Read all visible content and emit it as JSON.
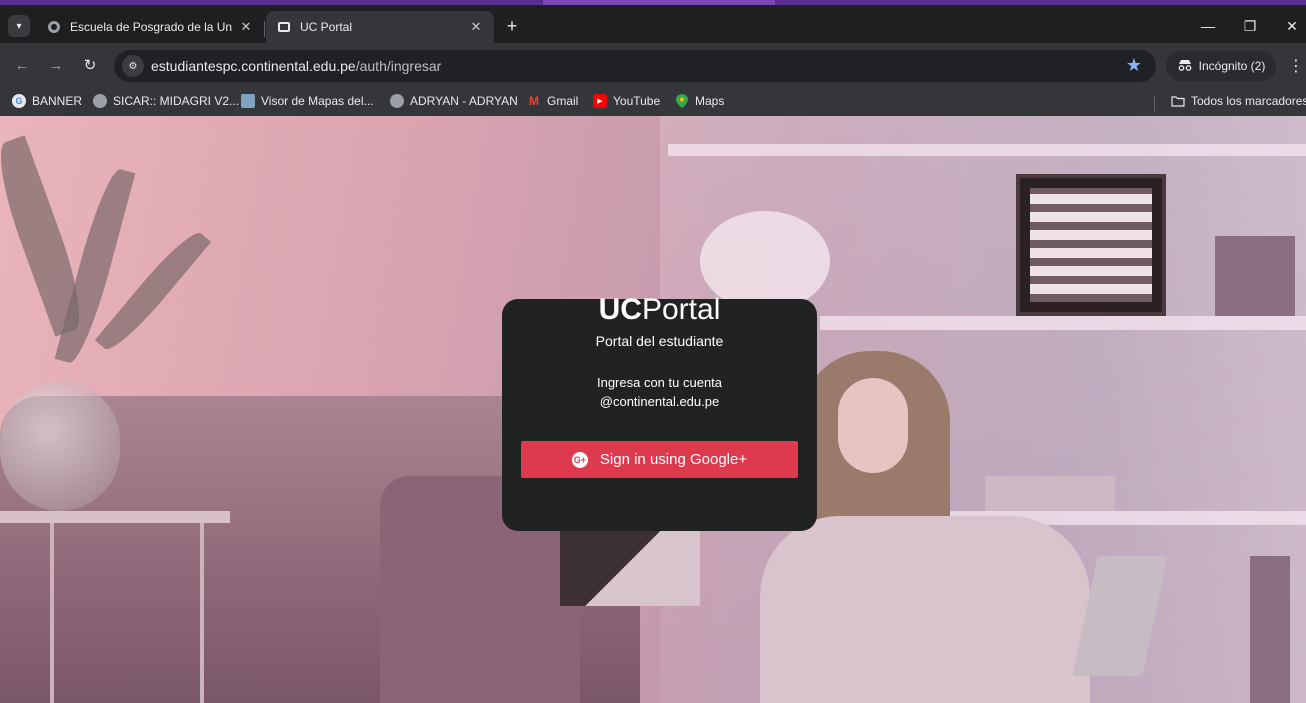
{
  "browser": {
    "tabs": [
      {
        "title": "Escuela de Posgrado de la Unive",
        "favicon": "globe-icon",
        "active": false
      },
      {
        "title": "UC Portal",
        "favicon": "uc-portal-icon",
        "active": true
      }
    ],
    "new_tab_label": "+",
    "address": {
      "domain": "estudiantespc.continental.edu.pe",
      "path": "/auth/ingresar"
    },
    "profile_label": "Incógnito (2)",
    "bookmarks": [
      {
        "label": "BANNER",
        "icon": "google-icon"
      },
      {
        "label": "SICAR:: MIDAGRI V2...",
        "icon": "globe-icon"
      },
      {
        "label": "Visor de Mapas del...",
        "icon": "map-thumbnail-icon"
      },
      {
        "label": "ADRYAN - ADRYAN",
        "icon": "globe-icon"
      },
      {
        "label": "Gmail",
        "icon": "gmail-icon"
      },
      {
        "label": "YouTube",
        "icon": "youtube-icon"
      },
      {
        "label": "Maps",
        "icon": "maps-pin-icon"
      }
    ],
    "all_bookmarks_label": "Todos los marcadores",
    "accent_color": "#8ab4f8"
  },
  "login": {
    "brand_bold": "UC",
    "brand_regular": "Portal",
    "subtitle": "Portal del estudiante",
    "hint_line1": "Ingresa con tu cuenta",
    "hint_line2": "@continental.edu.pe",
    "google_button_label": "Sign in using Google+",
    "button_color": "#de3a4d"
  }
}
